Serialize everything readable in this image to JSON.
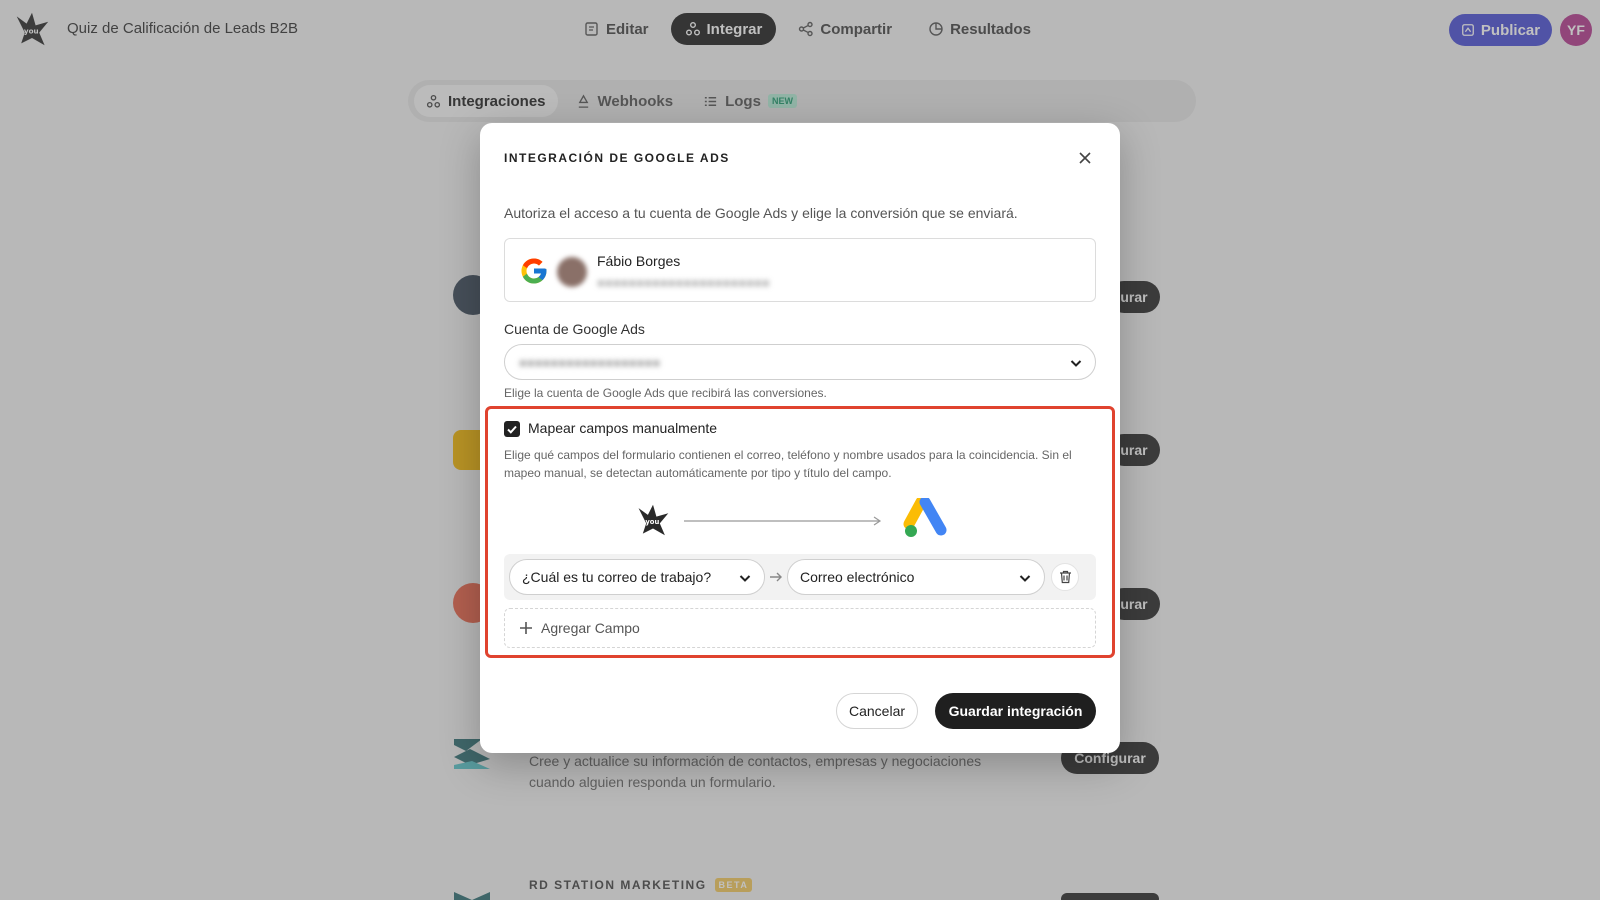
{
  "app": {
    "title": "Quiz de Calificación de Leads B2B",
    "nav": [
      {
        "label": "Editar",
        "icon": "edit-icon"
      },
      {
        "label": "Integrar",
        "icon": "integrate-icon",
        "active": true
      },
      {
        "label": "Compartir",
        "icon": "share-icon"
      },
      {
        "label": "Resultados",
        "icon": "results-icon"
      }
    ],
    "publish_label": "Publicar",
    "user_initials": "YF"
  },
  "subtabs": [
    {
      "label": "Integraciones",
      "active": true
    },
    {
      "label": "Webhooks"
    },
    {
      "label": "Logs",
      "badge": "NEW"
    }
  ],
  "background": {
    "configure_label_partial": "urar",
    "configure_label": "Configurar",
    "hubspot_desc": "Cree y actualice su información de contactos, empresas y negociaciones cuando alguien responda un formulario.",
    "section_title": "RD STATION MARKETING",
    "section_badge": "BETA"
  },
  "modal": {
    "title": "INTEGRACIÓN DE GOOGLE ADS",
    "intro": "Autoriza el acceso a tu cuenta de Google Ads y elige la conversión que se enviará.",
    "account": {
      "name": "Fábio Borges"
    },
    "ads_account": {
      "label": "Cuenta de Google Ads",
      "hint": "Elige la cuenta de Google Ads que recibirá las conversiones."
    },
    "manual_mapping": {
      "label": "Mapear campos manualmente",
      "checked": true,
      "description": "Elige qué campos del formulario contienen el correo, teléfono y nombre usados para la coincidencia. Sin el mapeo manual, se detectan automáticamente por tipo y título del campo.",
      "rows": [
        {
          "source": "¿Cuál es tu correo de trabajo?",
          "target": "Correo electrónico"
        }
      ],
      "add_label": "Agregar Campo"
    },
    "cancel_label": "Cancelar",
    "save_label": "Guardar integración"
  },
  "colors": {
    "highlight": "#e0432f",
    "publish": "#4b4fd6",
    "primary": "#1f1f1f"
  }
}
